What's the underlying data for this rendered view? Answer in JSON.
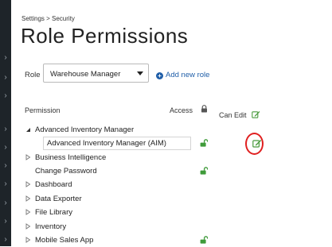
{
  "breadcrumb": "Settings > Security",
  "title": "Role Permissions",
  "role": {
    "label": "Role",
    "selected": "Warehouse Manager",
    "add_label": "Add new role"
  },
  "table": {
    "col_permission": "Permission",
    "col_access": "Access",
    "col_can_edit": "Can Edit",
    "rows": [
      {
        "label": "Advanced Inventory Manager",
        "expander": "expanded",
        "access": false
      },
      {
        "label": "Advanced Inventory Manager (AIM)",
        "expander": "none",
        "access": true,
        "selected": true,
        "can_edit_icon": "edit-icon"
      },
      {
        "label": "Business Intelligence",
        "expander": "collapsed",
        "access": false
      },
      {
        "label": "Change Password",
        "expander": "none",
        "access": true
      },
      {
        "label": "Dashboard",
        "expander": "collapsed",
        "access": false
      },
      {
        "label": "Data Exporter",
        "expander": "collapsed",
        "access": false
      },
      {
        "label": "File Library",
        "expander": "collapsed",
        "access": false
      },
      {
        "label": "Inventory",
        "expander": "collapsed",
        "access": false
      },
      {
        "label": "Mobile Sales App",
        "expander": "collapsed",
        "access": true
      }
    ]
  },
  "colors": {
    "accent": "#1f5ea8",
    "unlock": "#3f9b3a",
    "highlight": "#e02020",
    "sidebar": "#1e2429"
  }
}
